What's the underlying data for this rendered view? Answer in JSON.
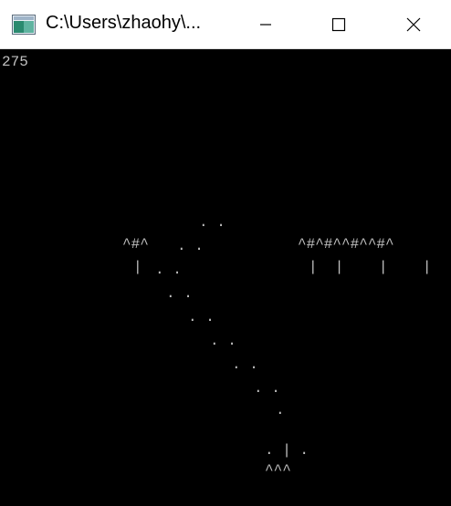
{
  "window": {
    "title": "C:\\Users\\zhaohy\\..."
  },
  "game": {
    "score": "275",
    "player": {
      "row1": ". | .",
      "row2": "^^^"
    },
    "obstacle_left": {
      "top": "^#^",
      "bottom": "|"
    },
    "obstacle_right": {
      "top": "^#^#^^#^^#^",
      "bottom": "|  |    |    |"
    },
    "trail_glyph": ".",
    "trail_pair": ". ."
  },
  "colors": {
    "background": "#000000",
    "text": "#c0c0c0",
    "titlebar": "#ffffff"
  },
  "icons": [
    "console-app-icon",
    "minimize-icon",
    "maximize-icon",
    "close-icon"
  ]
}
